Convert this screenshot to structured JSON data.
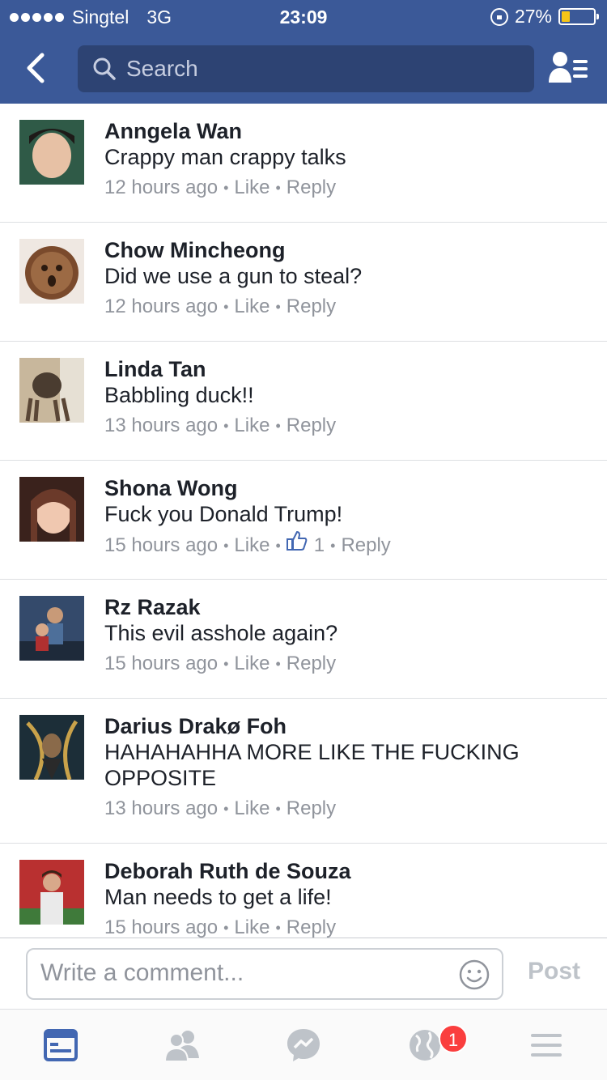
{
  "status_bar": {
    "carrier": "Singtel",
    "network": "3G",
    "time": "23:09",
    "battery": "27%",
    "battery_level": 0.27
  },
  "header": {
    "search_placeholder": "Search",
    "back_icon": "chevron-left-icon",
    "profile_icon": "profile-list-icon"
  },
  "comments": [
    {
      "name": "Anngela Wan",
      "text": "Crappy man crappy talks",
      "time": "12 hours ago",
      "like": "Like",
      "reply": "Reply",
      "avatar_color": "#3f6b55"
    },
    {
      "name": "Chow Mincheong",
      "text": "Did we use a gun to steal?",
      "time": "12 hours ago",
      "like": "Like",
      "reply": "Reply",
      "avatar_color": "#8a5a3b"
    },
    {
      "name": "Linda Tan",
      "text": "Babbling duck!!",
      "time": "13 hours ago",
      "like": "Like",
      "reply": "Reply",
      "avatar_color": "#9e8466"
    },
    {
      "name": "Shona Wong",
      "text": "Fuck you Donald Trump!",
      "time": "15 hours ago",
      "like": "Like",
      "likes_count": "1",
      "reply": "Reply",
      "avatar_color": "#4a2a22"
    },
    {
      "name": "Rz Razak",
      "text": "This evil asshole again?",
      "time": "15 hours ago",
      "like": "Like",
      "reply": "Reply",
      "avatar_color": "#2f4a72"
    },
    {
      "name": "Darius Drakø Foh",
      "text": "HAHAHAHHA MORE LIKE THE FUCKING OPPOSITE",
      "time": "13 hours ago",
      "like": "Like",
      "reply": "Reply",
      "avatar_color": "#2a3d4a"
    },
    {
      "name": "Deborah Ruth de Souza",
      "text": "Man needs to get a life!",
      "time": "15 hours ago",
      "like": "Like",
      "reply": "Reply",
      "avatar_color": "#b83a3a"
    }
  ],
  "composer": {
    "placeholder": "Write a comment...",
    "post_label": "Post"
  },
  "tabbar": {
    "items": [
      "news-feed-icon",
      "friends-icon",
      "messenger-icon",
      "notifications-globe-icon",
      "menu-icon"
    ],
    "active": "news-feed-icon",
    "notification_count": "1"
  },
  "colors": {
    "brand": "#3b5998",
    "search_bg": "#2d4373",
    "meta_text": "#90949c",
    "badge": "#fa3e3e"
  }
}
